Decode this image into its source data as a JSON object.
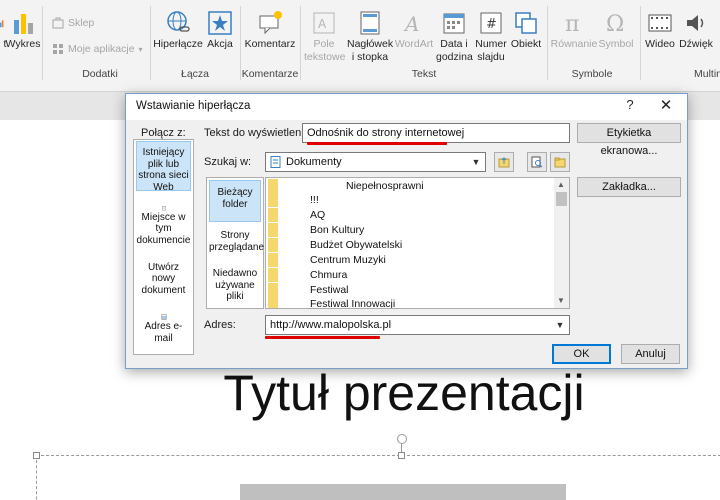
{
  "ribbon": {
    "chart_label": "t",
    "smartart_label": "Wykres",
    "store_label": "Sklep",
    "myapps_label": "Moje aplikacje",
    "hyperlink_label": "Hiperłącze",
    "action_label": "Akcja",
    "comment_label": "Komentarz",
    "textbox_label": "Pole tekstowe",
    "header_label": "Nagłówek i stopka",
    "wordart_label": "WordArt",
    "datetime_label": "Data i godzina",
    "slidenum_label": "Numer slajdu",
    "object_label": "Obiekt",
    "equation_label": "Równanie",
    "symbol_label": "Symbol",
    "video_label": "Wideo",
    "audio_label": "Dźwięk",
    "groups": {
      "addins": "Dodatki",
      "links": "Łącza",
      "comments": "Komentarze",
      "text": "Tekst",
      "symbols": "Symbole",
      "media": "Multim"
    }
  },
  "dialog": {
    "title": "Wstawianie hiperłącza",
    "help": "?",
    "close": "✕",
    "linkto_label": "Połącz z:",
    "linkto_items": [
      "Istniejący plik lub strona sieci Web",
      "Miejsce w tym dokumencie",
      "Utwórz nowy dokument",
      "Adres e-mail"
    ],
    "text_label": "Tekst do wyświetlenia:",
    "text_value": "Odnośnik do strony internetowej",
    "screentip_button": "Etykietka ekranowa...",
    "lookin_label": "Szukaj w:",
    "lookin_value": "Dokumenty",
    "bookmark_button": "Zakładka...",
    "lookin_items": [
      "Bieżący folder",
      "Strony przeglądane",
      "Niedawno używane pliki"
    ],
    "files": [
      "Niepełnosprawni",
      "!!!",
      "AQ",
      "Bon Kultury",
      "Budżet Obywatelski",
      "Centrum Muzyki",
      "Chmura",
      "Festiwal",
      "Festiwal Innowacji"
    ],
    "address_label": "Adres:",
    "address_value": "http://www.malopolska.pl",
    "ok_button": "OK",
    "cancel_button": "Anuluj"
  },
  "slide": {
    "title": "Tytuł prezentacji"
  },
  "colors": {
    "accent": "#0078d7",
    "underline": "#e00000",
    "selection": "#cce4f7"
  }
}
